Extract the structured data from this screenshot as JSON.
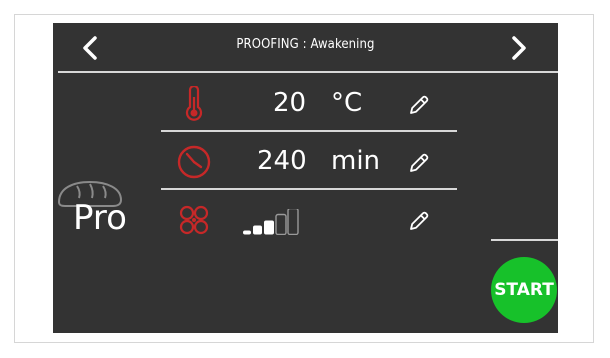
{
  "header": {
    "title": "PROOFING : Awakening",
    "prev_icon": "chevron-left-icon",
    "next_icon": "chevron-right-icon"
  },
  "rows": [
    {
      "icon": "thermometer-icon",
      "value": "20",
      "unit": "°C"
    },
    {
      "icon": "clock-icon",
      "value": "240",
      "unit": "min"
    },
    {
      "icon": "fan-icon",
      "fan_level": 3,
      "fan_levels_total": 5
    }
  ],
  "mode": {
    "label": "Pro",
    "icon": "bread-icon"
  },
  "start_button": {
    "label": "START"
  },
  "colors": {
    "screen_bg": "#333333",
    "accent_red": "#c62828",
    "start_green": "#17c12a",
    "text": "#ffffff"
  }
}
